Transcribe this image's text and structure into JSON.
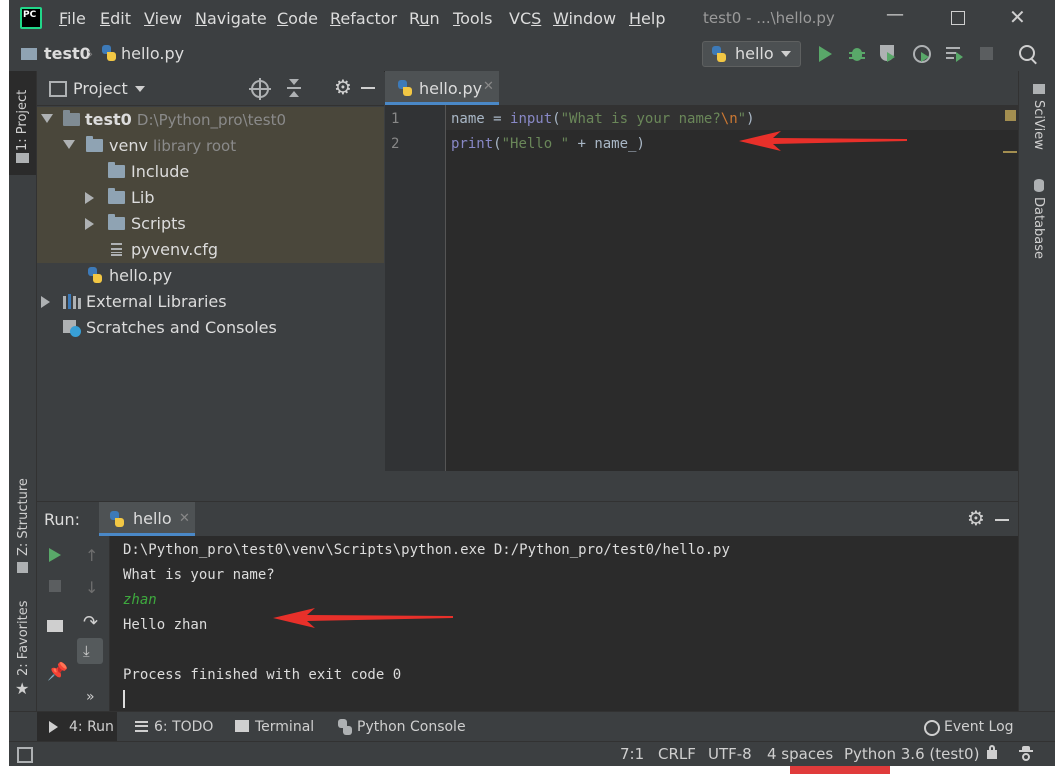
{
  "menubar": {
    "app_icon": "PC",
    "items": [
      "File",
      "Edit",
      "View",
      "Navigate",
      "Code",
      "Refactor",
      "Run",
      "Tools",
      "VCS",
      "Window",
      "Help"
    ],
    "window_title": "test0 - ...\\hello.py"
  },
  "navbar": {
    "crumb_project": "test0",
    "crumb_file": "hello.py",
    "run_config": "hello"
  },
  "left_stripe": {
    "project_tab": "1: Project",
    "structure_tab": "Z: Structure",
    "favorites_tab": "2: Favorites"
  },
  "right_stripe": {
    "sciview": "SciView",
    "database": "Database"
  },
  "project_panel": {
    "title": "Project",
    "tree": [
      {
        "label": "test0",
        "sub": "D:\\Python_pro\\test0"
      },
      {
        "label": "venv",
        "sub": "library root"
      },
      {
        "label": "Include",
        "sub": ""
      },
      {
        "label": "Lib",
        "sub": ""
      },
      {
        "label": "Scripts",
        "sub": ""
      },
      {
        "label": "pyvenv.cfg",
        "sub": ""
      },
      {
        "label": "hello.py",
        "sub": ""
      },
      {
        "label": "External Libraries",
        "sub": ""
      },
      {
        "label": "Scratches and Consoles",
        "sub": ""
      }
    ]
  },
  "editor": {
    "tab_label": "hello.py",
    "line_numbers": [
      "1",
      "2"
    ],
    "line1": {
      "a": "name = ",
      "fn": "input",
      "b": "(",
      "str": "\"What is your name?",
      "esc": "\\n",
      "str2": "\"",
      "c": ")"
    },
    "line2": {
      "fn": "print",
      "b": "(",
      "str": "\"Hello \"",
      "c": " + name_)"
    }
  },
  "run_panel": {
    "label": "Run:",
    "tab": "hello",
    "output": [
      "D:\\Python_pro\\test0\\venv\\Scripts\\python.exe D:/Python_pro/test0/hello.py",
      "What is your name?",
      "zhan",
      "Hello zhan",
      "",
      "Process finished with exit code 0"
    ]
  },
  "bottom_tabs": {
    "run": "4: Run",
    "todo": "6: TODO",
    "terminal": "Terminal",
    "python_console": "Python Console",
    "event_log": "Event Log"
  },
  "status": {
    "position": "7:1",
    "line_sep": "CRLF",
    "encoding": "UTF-8",
    "indent": "4 spaces",
    "interpreter": "Python 3.6 (test0)"
  },
  "colors": {
    "accent": "#4a88c7",
    "run_green": "#59a869",
    "annotation_red": "#e8302a"
  }
}
